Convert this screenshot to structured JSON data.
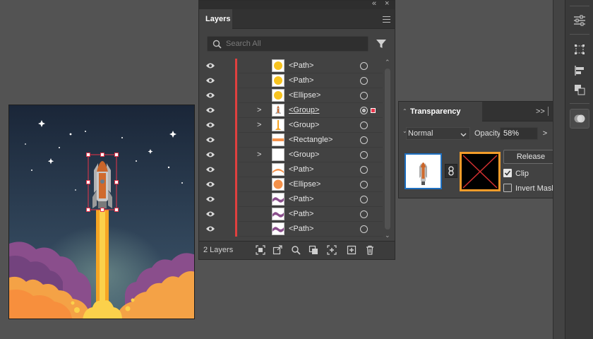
{
  "layers_panel": {
    "tab_label": "Layers",
    "collapse_glyph": "«",
    "close_glyph": "×",
    "search_placeholder": "Search All",
    "footer_count": "2 Layers",
    "rows": [
      {
        "name": "<Path>",
        "thumb": "yellow-circle",
        "expand": false,
        "target": "empty",
        "selected": false
      },
      {
        "name": "<Path>",
        "thumb": "yellow-circle",
        "expand": false,
        "target": "empty",
        "selected": false
      },
      {
        "name": "<Ellipse>",
        "thumb": "yellow-circle",
        "expand": false,
        "target": "empty",
        "selected": false
      },
      {
        "name": "<Group>",
        "thumb": "rocket",
        "expand": true,
        "target": "targeted",
        "selected": true
      },
      {
        "name": "<Group>",
        "thumb": "flame",
        "expand": true,
        "target": "empty",
        "selected": false
      },
      {
        "name": "<Rectangle>",
        "thumb": "orange-stripe",
        "expand": false,
        "target": "empty",
        "selected": false
      },
      {
        "name": "<Group>",
        "thumb": "blank",
        "expand": true,
        "target": "empty",
        "selected": false
      },
      {
        "name": "<Path>",
        "thumb": "orange-curve",
        "expand": false,
        "target": "empty",
        "selected": false
      },
      {
        "name": "<Ellipse>",
        "thumb": "orange-circle",
        "expand": false,
        "target": "empty",
        "selected": false
      },
      {
        "name": "<Path>",
        "thumb": "purple-wave",
        "expand": false,
        "target": "empty",
        "selected": false
      },
      {
        "name": "<Path>",
        "thumb": "purple-wave",
        "expand": false,
        "target": "empty",
        "selected": false
      },
      {
        "name": "<Path>",
        "thumb": "purple-wave",
        "expand": false,
        "target": "empty",
        "selected": false
      }
    ],
    "footer_icons": [
      "collect-for-export-icon",
      "export-icon",
      "locate-object-icon",
      "make-clipping-mask-icon",
      "new-sublayer-icon",
      "new-layer-icon",
      "delete-icon"
    ]
  },
  "transparency_panel": {
    "tab_label": "Transparency",
    "more_glyph": ">>",
    "blend_mode": "Normal",
    "opacity_label": "Opacity:",
    "opacity_value": "58%",
    "opacity_arrow": ">",
    "release_label": "Release",
    "clip_label": "Clip",
    "clip_checked": true,
    "invert_label": "Invert Mask",
    "invert_checked": false
  },
  "colors": {
    "layer_color": "#e0403f",
    "selection_marker": "#e8344a",
    "mask_highlight": "#f39c2a",
    "artwork_thumb_border": "#1e6fc0",
    "sky_top": "#1a2638",
    "sky_bottom": "#3d5a6e",
    "cloud_purple": "#8a4e8c",
    "cloud_orange": "#f4a246",
    "flame": "#f6a524"
  },
  "toolstrip": {
    "icons": [
      "properties-icon",
      "transform-icon",
      "align-icon",
      "pathfinder-icon",
      "transparency-icon"
    ],
    "active": "transparency-icon"
  }
}
